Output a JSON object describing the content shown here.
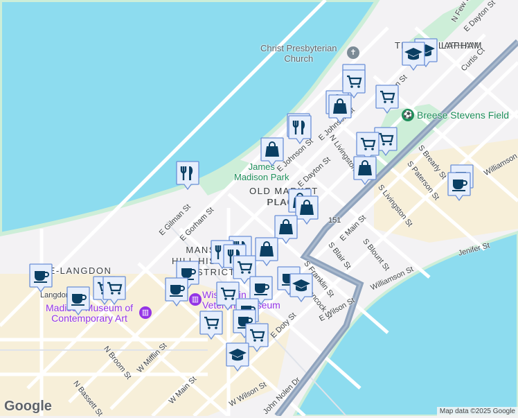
{
  "map": {
    "colors": {
      "water": "#8ddcef",
      "land": "#f3f2f4",
      "park": "#cdeed8",
      "highway": "#8fa3bd",
      "road": "#ffffff",
      "commercial": "#f7efd9",
      "marker_bg": "#e6eefc",
      "marker_border": "#6a8fd6",
      "marker_icon": "#0a3f63"
    },
    "neighborhoods": [
      "MANSION HILL HISTORIC DISTRICT",
      "OLD MARKET PLACE",
      "TENNEY-LAPHAM",
      "MANSION",
      "HILL HISTORIC",
      "DISTRICT",
      "OLD MA",
      "PLACE",
      "ATE-LANGDON",
      "T",
      "LAPHAM"
    ],
    "pois": {
      "church": "Christ Presbyterian Church",
      "church_l1": "Christ Presbyterian",
      "church_l2": "Church",
      "field": "Breese Stevens Field",
      "park_l1": "James",
      "park_l2": "Madison Park",
      "museum_l1": "Madison Museum of",
      "museum_l2": "Contemporary Art",
      "vet_l1": "Wisconsin",
      "vet_l2": "Veterans Museum"
    },
    "streets": [
      "N Few St",
      "E Dayton St",
      "Curtis Ct",
      "E Johnson St",
      "E Johnson St",
      "N Livingston St",
      "E Dayton St",
      "S Livingston St",
      "S Paterson St",
      "S Brearly St",
      "Williamson St",
      "Williamson St",
      "Jenifer St",
      "E Gorham St",
      "E Gilman St",
      "E Main St",
      "S Blount St",
      "S Blair St",
      "S Franklin St",
      "E Wilson St",
      "E Doty St",
      "N Broom St",
      "W Mifflin St",
      "N Bassett St",
      "W Main St",
      "W Wilson St",
      "John Nolen Dr",
      "Langdon St",
      "151",
      "Dayton St",
      "N Hancock St"
    ],
    "attribution": "Map data ©2025 Google",
    "logo": "Google"
  }
}
